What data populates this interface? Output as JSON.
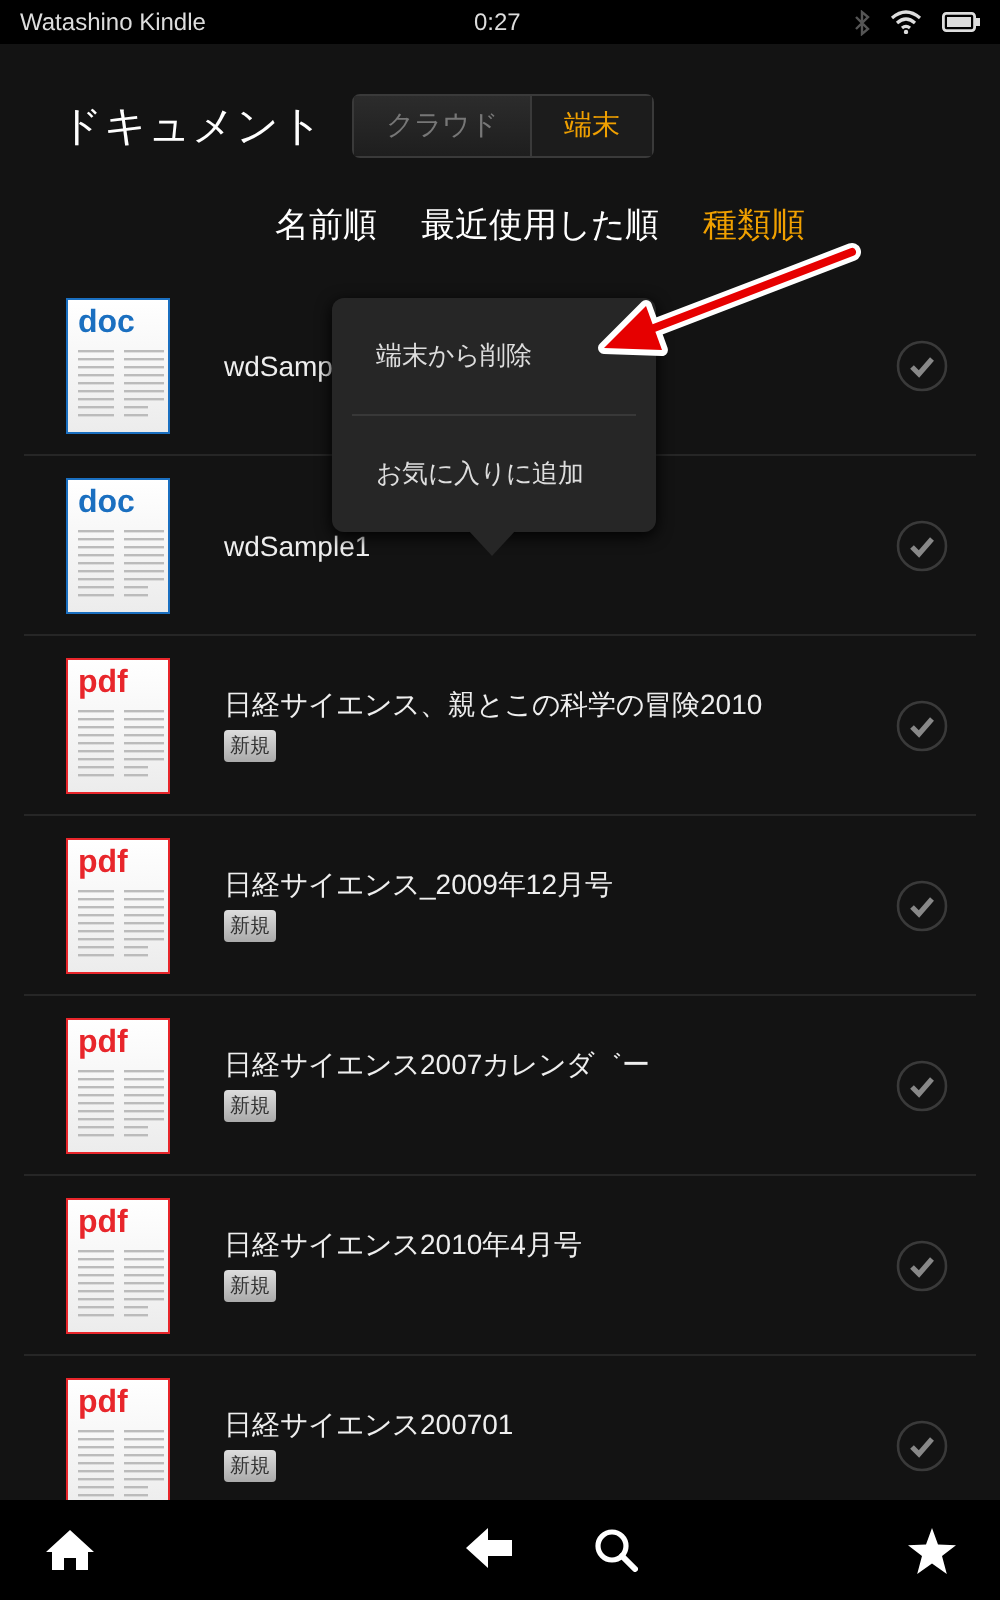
{
  "status_bar": {
    "device_name": "Watashino Kindle",
    "time": "0:27"
  },
  "header": {
    "title": "ドキュメント",
    "tabs": [
      {
        "label": "クラウド",
        "selected": false
      },
      {
        "label": "端末",
        "selected": true
      }
    ]
  },
  "sort_options": [
    {
      "label": "名前順",
      "selected": false
    },
    {
      "label": "最近使用した順",
      "selected": false
    },
    {
      "label": "種類順",
      "selected": true
    }
  ],
  "documents": [
    {
      "kind": "doc",
      "type_label": "doc",
      "title": "wdSamp"
    },
    {
      "kind": "doc",
      "type_label": "doc",
      "title": "wdSample1"
    },
    {
      "kind": "pdf",
      "type_label": "pdf",
      "title": "日経サイエンス、親とこの科学の冒険2010",
      "badge": "新規"
    },
    {
      "kind": "pdf",
      "type_label": "pdf",
      "title": "日経サイエンス_2009年12月号",
      "badge": "新規"
    },
    {
      "kind": "pdf",
      "type_label": "pdf",
      "title": "日経サイエンス2007カレンダ゛ー",
      "badge": "新規"
    },
    {
      "kind": "pdf",
      "type_label": "pdf",
      "title": "日経サイエンス2010年4月号",
      "badge": "新規"
    },
    {
      "kind": "pdf",
      "type_label": "pdf",
      "title": "日経サイエンス200701",
      "badge": "新規"
    }
  ],
  "context_menu": {
    "items": [
      "端末から削除",
      "お気に入りに追加"
    ]
  }
}
